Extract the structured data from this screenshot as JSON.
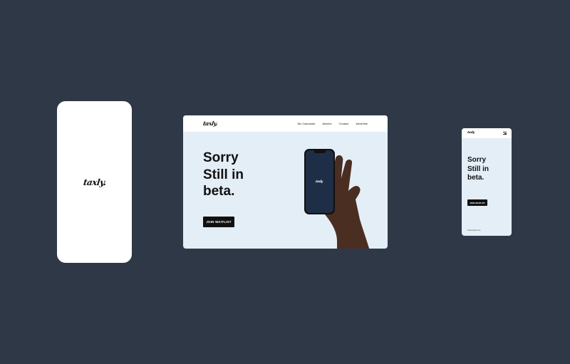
{
  "brand": {
    "logo_text": "taxly."
  },
  "desktop": {
    "nav_links": [
      "Tax Calculator",
      "Articles",
      "Contact",
      "Advertise"
    ],
    "hero_lines": [
      "Sorry",
      "Still in",
      "beta."
    ],
    "cta_label": "JOIN WAITLIST"
  },
  "mobile": {
    "menu_icon": "hamburger-menu-icon",
    "hero_lines": [
      "Sorry",
      "Still in",
      "beta."
    ],
    "cta_label": "JOIN WAITLIST",
    "footer_text": "www.taxly.com"
  },
  "colors": {
    "background": "#2e3847",
    "hero_background": "#e4eef7",
    "cta": "#111111",
    "phone_screen": "#1f2e47"
  }
}
